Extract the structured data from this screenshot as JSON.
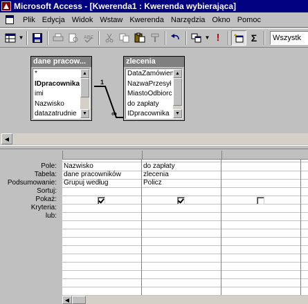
{
  "window": {
    "title": "Microsoft Access - [Kwerenda1 : Kwerenda wybierająca]"
  },
  "menu": {
    "items": [
      {
        "label": "Plik"
      },
      {
        "label": "Edycja"
      },
      {
        "label": "Widok"
      },
      {
        "label": "Wstaw"
      },
      {
        "label": "Kwerenda"
      },
      {
        "label": "Narzędzia"
      },
      {
        "label": "Okno"
      },
      {
        "label": "Pomoc"
      }
    ]
  },
  "toolbar": {
    "combo_value": "Wszystk",
    "icons": [
      "view-icon",
      "save-icon",
      "print-icon",
      "print-preview-icon",
      "spelling-icon",
      "cut-icon",
      "copy-icon",
      "paste-icon",
      "format-painter-icon",
      "undo-icon",
      "query-type-icon",
      "run-icon",
      "show-table-icon",
      "totals-icon"
    ]
  },
  "tables": [
    {
      "title": "dane pracow...",
      "fields": [
        "*",
        "IDpracownika",
        "imi",
        "Nazwisko",
        "datazatrudnie"
      ]
    },
    {
      "title": "zlecenia",
      "fields": [
        "DataZamówien",
        "NazwaPrzesył",
        "MiastoOdbiorc",
        "do zapłaty",
        "IDpracownika"
      ]
    }
  ],
  "join": {
    "one_label": "1",
    "many_label": "∞"
  },
  "grid": {
    "row_labels": [
      "Pole:",
      "Tabela:",
      "Podsumowanie:",
      "Sortuj:",
      "Pokaż:",
      "Kryteria:",
      "lub:"
    ],
    "columns": [
      {
        "field": "Nazwisko",
        "table": "dane pracowników",
        "total": "Grupuj według",
        "sort": "",
        "show": true
      },
      {
        "field": "do zapłaty",
        "table": "zlecenia",
        "total": "Policz",
        "sort": "",
        "show": true
      },
      {
        "field": "",
        "table": "",
        "total": "",
        "sort": "",
        "show": false
      }
    ]
  }
}
